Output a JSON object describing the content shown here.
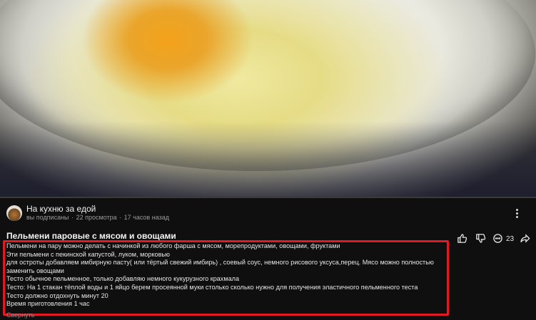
{
  "channel": {
    "name": "На кухню за едой",
    "subscribed": "вы подписаны",
    "views": "22 просмотра",
    "time": "17 часов назад"
  },
  "video": {
    "title": "Пельмени паровые с мясом и овощами"
  },
  "actions": {
    "comments_count": "23"
  },
  "description": {
    "lines": [
      "Пельмени на пару можно делать с начинкой из любого фарша с мясом, морепродуктами, овощами, фруктами",
      "Эти пельмени с пекинской капустой, луком, морковью",
      "для остроты добавляем имбирную пасту( или тёртый свежий имбирь) , соевый соус, немного рисового уксуса,перец. Мясо можно полностью",
      "заменить овощами",
      "Тесто обычное пельменное, только добавляю немного кукурузного крахмала",
      "Тесто: На 1 стакан тёплой воды и 1 яйцо берем просеянной муки столько сколько нужно для получения эластичного пельменного теста",
      "Тесто должно отдохнуть минут 20",
      "Время приготовления 1 час"
    ],
    "collapse_label": "Свернуть"
  },
  "colors": {
    "highlight": "#e01b24",
    "background": "#0f0f10"
  }
}
